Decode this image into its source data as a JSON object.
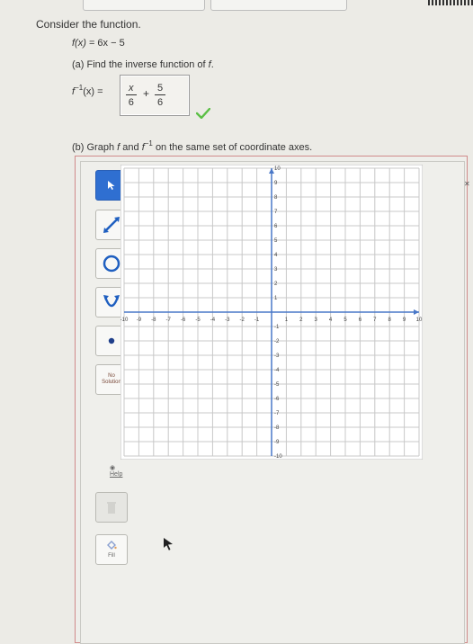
{
  "prompt": "Consider the function.",
  "function": {
    "lhs": "f(x)",
    "rhs": "= 6x − 5"
  },
  "part_a": {
    "label": "(a) Find the inverse function of",
    "f": "f",
    "period": "."
  },
  "inverse": {
    "label_base": "f",
    "label_sup": "−1",
    "label_rest": "(x) =",
    "term1": {
      "num": "x",
      "den": "6"
    },
    "op": "+",
    "term2": {
      "num": "5",
      "den": "6"
    },
    "status": "correct"
  },
  "part_b": {
    "label_start": "(b) Graph",
    "f": "f",
    "and": "and",
    "f2": "f",
    "sup": "−1",
    "label_end": "on the same set of coordinate axes."
  },
  "tools": {
    "no_solution_line1": "No",
    "no_solution_line2": "Solution",
    "help": "Help",
    "fill": "Fill"
  },
  "graph": {
    "x_min": -10,
    "x_max": 10,
    "y_min": -10,
    "y_max": 10,
    "x_ticks": [
      "-10",
      "-9",
      "-8",
      "-7",
      "-6",
      "-5",
      "-4",
      "-3",
      "-2",
      "-1",
      "1",
      "2",
      "3",
      "4",
      "5",
      "6",
      "7",
      "8",
      "9",
      "10"
    ],
    "y_ticks": [
      "10",
      "9",
      "8",
      "7",
      "6",
      "5",
      "4",
      "3",
      "2",
      "1",
      "-1",
      "-2",
      "-3",
      "-4",
      "-5",
      "-6",
      "-7",
      "-8",
      "-9",
      "-10"
    ]
  },
  "colors": {
    "check": "#5bbf45",
    "active_tool": "#2f6fd1",
    "grid": "#c8c8c8",
    "axis": "#4a78c8"
  }
}
